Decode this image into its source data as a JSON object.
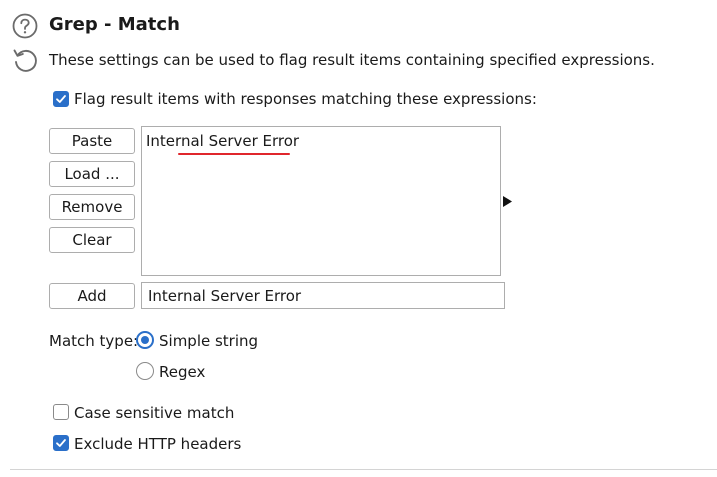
{
  "header": {
    "title": "Grep - Match",
    "description": "These settings can be used to flag result items containing specified expressions."
  },
  "flag_option": {
    "label": "Flag result items with responses matching these expressions:",
    "checked": true
  },
  "buttons": {
    "paste": "Paste",
    "load": "Load ...",
    "remove": "Remove",
    "clear": "Clear",
    "add": "Add"
  },
  "expressions": {
    "items": [
      "Internal Server Error"
    ]
  },
  "new_expression": {
    "value": "Internal Server Error"
  },
  "match_type": {
    "label": "Match type:",
    "options": [
      {
        "label": "Simple string",
        "selected": true
      },
      {
        "label": "Regex",
        "selected": false
      }
    ]
  },
  "options": {
    "case_sensitive": {
      "label": "Case sensitive match",
      "checked": false
    },
    "exclude_headers": {
      "label": "Exclude HTTP headers",
      "checked": true
    }
  },
  "colors": {
    "accent": "#2a6fc9",
    "spellcheck": "#e0262c"
  }
}
